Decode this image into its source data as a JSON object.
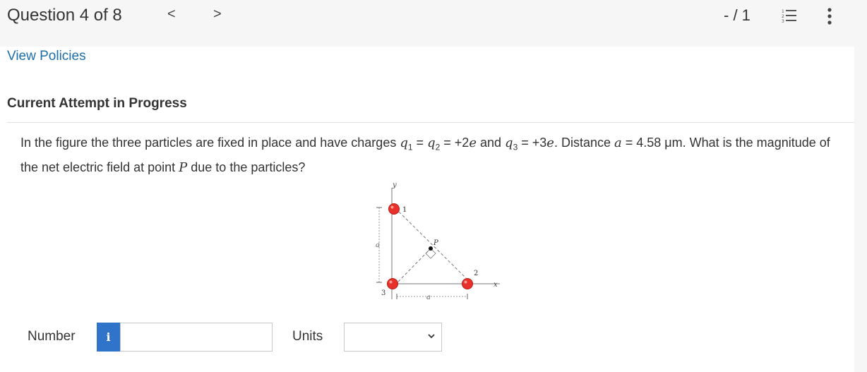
{
  "header": {
    "question_label": "Question 4 of 8",
    "prev_symbol": "<",
    "next_symbol": ">",
    "score": "- / 1"
  },
  "links": {
    "view_policies": "View Policies"
  },
  "attempt_heading": "Current Attempt in Progress",
  "question": {
    "part1": "In the figure the three particles are fixed in place and have charges ",
    "q1_sym": "q",
    "q1_sub": "1",
    "eq1": " = ",
    "q2_sym": "q",
    "q2_sub": "2",
    "eq2": " = +2",
    "e1": "e",
    "and": " and ",
    "q3_sym": "q",
    "q3_sub": "3",
    "eq3": " = +3",
    "e2": "e",
    "dist_text": ". Distance ",
    "a_sym": "a",
    "dist_val": " = 4.58 μm. What is the magnitude of the net electric field at point ",
    "p_sym": "P",
    "tail": " due to the particles?"
  },
  "figure": {
    "y_axis": "y",
    "x_axis": "x",
    "label_1": "1",
    "label_2": "2",
    "label_3": "3",
    "label_p": "P",
    "label_a_vertical": "a",
    "label_a_horizontal": "a",
    "colors": {
      "particle": "#e8312a",
      "particle_edge": "#b31d18",
      "axis": "#555555"
    }
  },
  "answer": {
    "number_label": "Number",
    "info_symbol": "i",
    "number_value": "",
    "units_label": "Units",
    "units_value": ""
  },
  "colors": {
    "link": "#1a6fa8",
    "info_button": "#2f74c8"
  }
}
